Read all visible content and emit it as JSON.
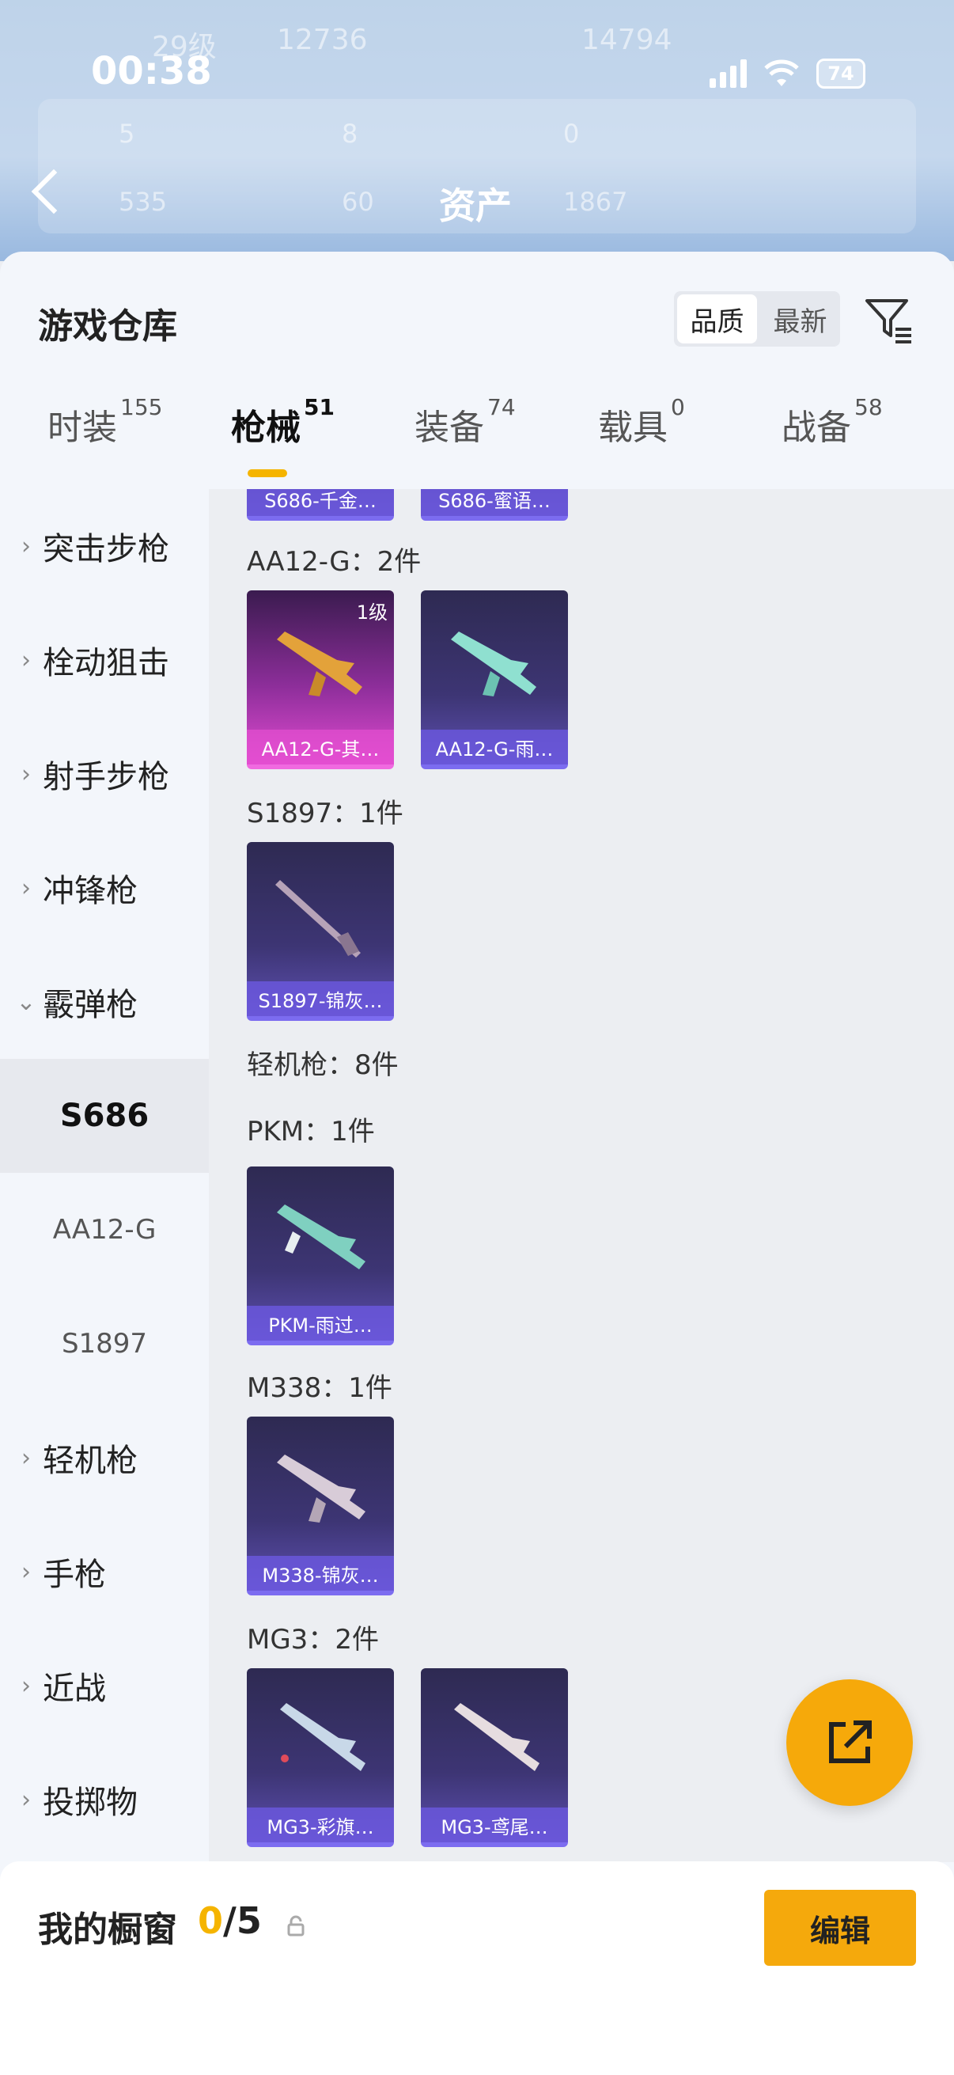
{
  "status": {
    "time": "00:38",
    "battery": "74"
  },
  "header_bg": {
    "level": "29级",
    "coins": "12736",
    "points": "14794",
    "stat1": "5",
    "stat2": "8",
    "stat3": "0",
    "stat4": "535",
    "stat5": "60",
    "stat6": "1867",
    "title": "资产"
  },
  "sheet": {
    "title": "游戏仓库",
    "sort": {
      "quality": "品质",
      "newest": "最新"
    }
  },
  "tabs": [
    {
      "label": "时装",
      "count": "155"
    },
    {
      "label": "枪械",
      "count": "51"
    },
    {
      "label": "装备",
      "count": "74"
    },
    {
      "label": "载具",
      "count": "0"
    },
    {
      "label": "战备",
      "count": "58"
    }
  ],
  "sidebar": {
    "categories": [
      "突击步枪",
      "栓动狙击",
      "射手步枪",
      "冲锋枪",
      "霰弹枪",
      "轻机枪",
      "手枪",
      "近战",
      "投掷物"
    ],
    "subs": [
      "S686",
      "AA12-G",
      "S1897"
    ]
  },
  "content": {
    "top_cards": [
      "S686-千金…",
      "S686-蜜语…"
    ],
    "groups": [
      {
        "title": "AA12-G：2件"
      },
      {
        "title": "S1897：1件"
      },
      {
        "title": "轻机枪：8件"
      },
      {
        "title": "PKM：1件"
      },
      {
        "title": "M338：1件"
      },
      {
        "title": "MG3：2件"
      }
    ],
    "cards": {
      "aa12_1": {
        "name": "AA12-G-其…",
        "level": "1级"
      },
      "aa12_2": {
        "name": "AA12-G-雨…"
      },
      "s1897": {
        "name": "S1897-锦灰…"
      },
      "pkm": {
        "name": "PKM-雨过…"
      },
      "m338": {
        "name": "M338-锦灰…"
      },
      "mg3_1": {
        "name": "MG3-彩旗…"
      },
      "mg3_2": {
        "name": "MG3-鸢尾…"
      }
    }
  },
  "bottom": {
    "label": "我的橱窗",
    "current": "0",
    "total": "/5",
    "edit": "编辑"
  },
  "colors": {
    "accent": "#f5b400",
    "card_purple": "#3d3574",
    "card_pink": "#e04bd0"
  }
}
